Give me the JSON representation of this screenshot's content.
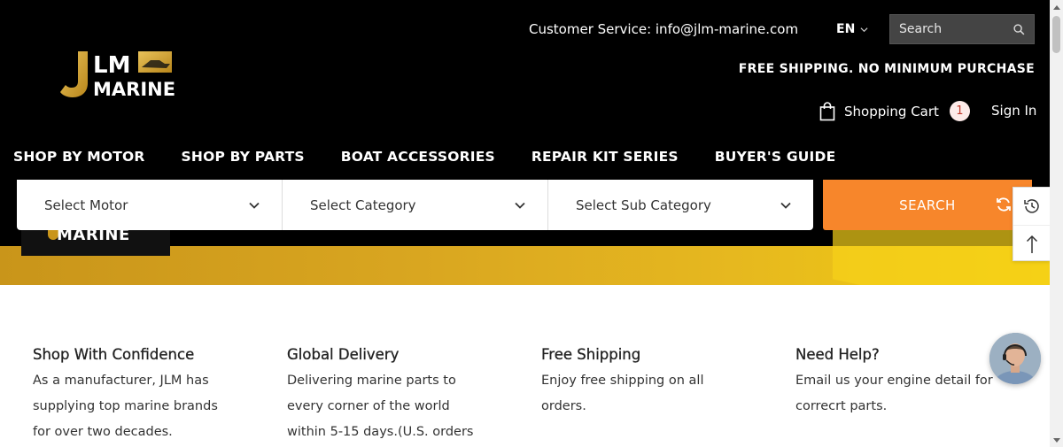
{
  "header": {
    "customer_service": "Customer Service: info@jlm-marine.com",
    "language": "EN",
    "search_placeholder": "Search",
    "free_shipping": "FREE SHIPPING. NO MINIMUM PURCHASE",
    "cart_label": "Shopping Cart",
    "cart_count": "1",
    "sign_in": "Sign In",
    "logo_text_top": "LM",
    "logo_text_bottom": "MARINE",
    "logo_letter": "J"
  },
  "nav": {
    "items": [
      {
        "label": "SHOP BY MOTOR"
      },
      {
        "label": "SHOP BY PARTS"
      },
      {
        "label": "BOAT ACCESSORIES"
      },
      {
        "label": "REPAIR KIT SERIES"
      },
      {
        "label": "BUYER'S GUIDE"
      }
    ]
  },
  "banner": {
    "logo_text": "MARINE"
  },
  "filter": {
    "motor": "Select Motor",
    "category": "Select Category",
    "sub_category": "Select Sub Category",
    "search_button": "SEARCH"
  },
  "features": [
    {
      "title": "Shop With Confidence",
      "text": "As a manufacturer, JLM has supplying top marine brands for over two decades."
    },
    {
      "title": "Global Delivery",
      "text": "Delivering marine parts to every corner of the world within 5-15 days.(U.S. orders"
    },
    {
      "title": "Free Shipping",
      "text": "Enjoy free shipping on all orders."
    },
    {
      "title": "Need Help?",
      "text": "Email us your engine detail for correcrt parts."
    }
  ],
  "colors": {
    "header_bg": "#000000",
    "accent_orange": "#f7862b",
    "gold": "#d9a620",
    "yellow": "#f2d00e"
  },
  "icons": {
    "search": "search-icon",
    "cart": "shopping-bag-icon",
    "history": "history-icon",
    "back_to_top": "arrow-up-icon",
    "refresh": "refresh-icon",
    "chat": "chat-agent-avatar"
  }
}
